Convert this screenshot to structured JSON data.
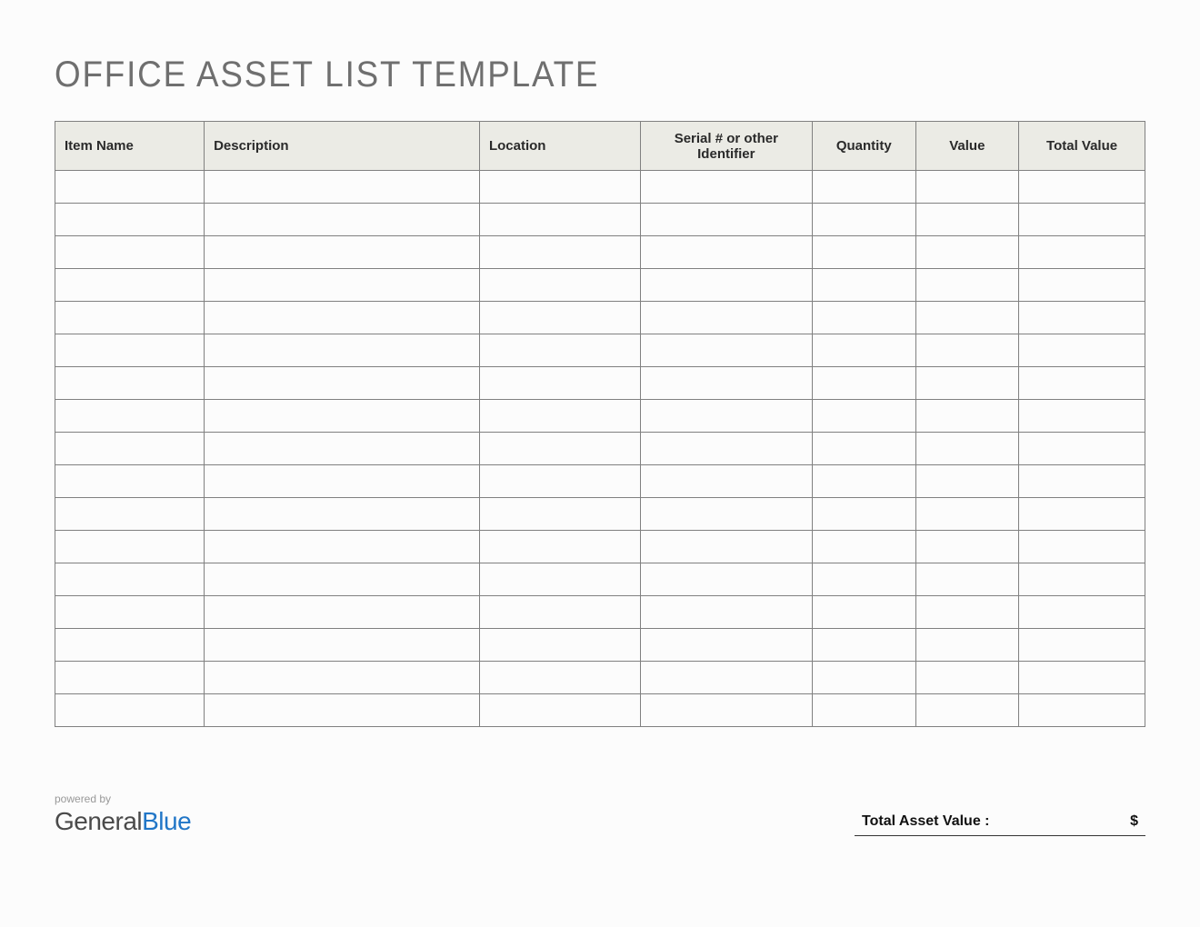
{
  "title": "OFFICE ASSET LIST TEMPLATE",
  "columns": [
    {
      "label": "Item Name",
      "width": "13%",
      "align": "left"
    },
    {
      "label": "Description",
      "width": "24%",
      "align": "left"
    },
    {
      "label": "Location",
      "width": "14%",
      "align": "left"
    },
    {
      "label": "Serial # or other Identifier",
      "width": "15%",
      "align": "center"
    },
    {
      "label": "Quantity",
      "width": "9%",
      "align": "center"
    },
    {
      "label": "Value",
      "width": "9%",
      "align": "center"
    },
    {
      "label": "Total Value",
      "width": "11%",
      "align": "center"
    }
  ],
  "rows": [
    [
      "",
      "",
      "",
      "",
      "",
      "",
      ""
    ],
    [
      "",
      "",
      "",
      "",
      "",
      "",
      ""
    ],
    [
      "",
      "",
      "",
      "",
      "",
      "",
      ""
    ],
    [
      "",
      "",
      "",
      "",
      "",
      "",
      ""
    ],
    [
      "",
      "",
      "",
      "",
      "",
      "",
      ""
    ],
    [
      "",
      "",
      "",
      "",
      "",
      "",
      ""
    ],
    [
      "",
      "",
      "",
      "",
      "",
      "",
      ""
    ],
    [
      "",
      "",
      "",
      "",
      "",
      "",
      ""
    ],
    [
      "",
      "",
      "",
      "",
      "",
      "",
      ""
    ],
    [
      "",
      "",
      "",
      "",
      "",
      "",
      ""
    ],
    [
      "",
      "",
      "",
      "",
      "",
      "",
      ""
    ],
    [
      "",
      "",
      "",
      "",
      "",
      "",
      ""
    ],
    [
      "",
      "",
      "",
      "",
      "",
      "",
      ""
    ],
    [
      "",
      "",
      "",
      "",
      "",
      "",
      ""
    ],
    [
      "",
      "",
      "",
      "",
      "",
      "",
      ""
    ],
    [
      "",
      "",
      "",
      "",
      "",
      "",
      ""
    ],
    [
      "",
      "",
      "",
      "",
      "",
      "",
      ""
    ]
  ],
  "footer": {
    "powered_by": "powered by",
    "brand_general": "General",
    "brand_blue": "Blue",
    "total_label": "Total Asset Value :",
    "total_currency": "$",
    "total_amount": ""
  }
}
